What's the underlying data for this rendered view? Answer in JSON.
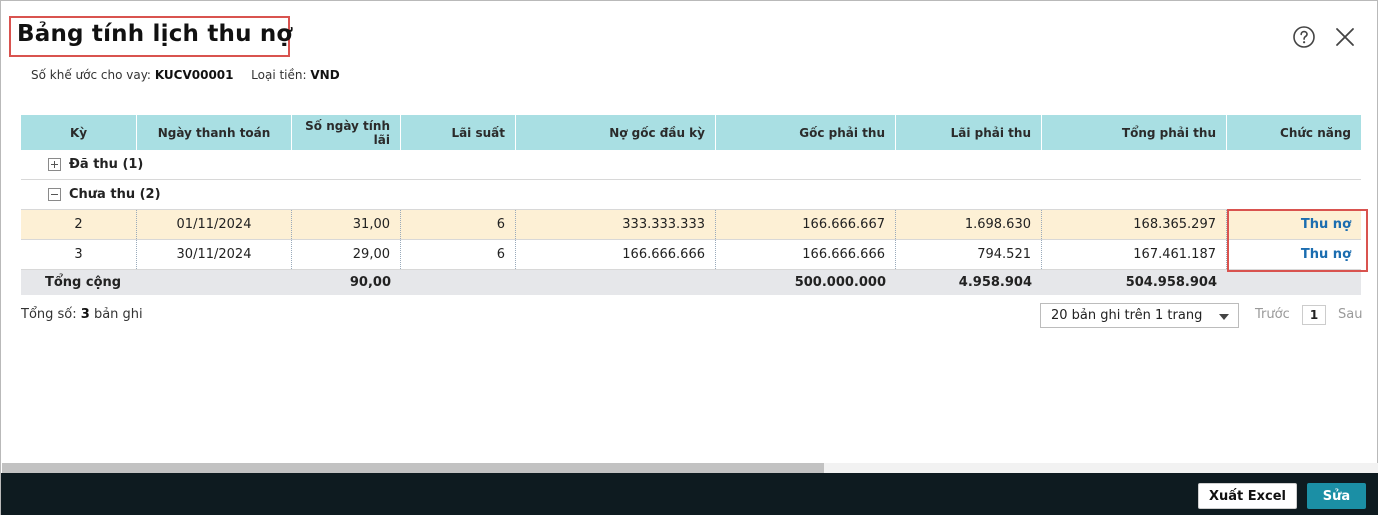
{
  "dialog": {
    "title": "Bảng tính lịch thu nợ",
    "contract_label": "Số khế ước cho vay:",
    "contract_value": "KUCV00001",
    "currency_label": "Loại tiền:",
    "currency_value": "VND"
  },
  "icons": {
    "help": "question-circle-icon",
    "close": "close-x-icon"
  },
  "table": {
    "headers": [
      "Kỳ",
      "Ngày thanh toán",
      "Số ngày tính lãi",
      "Lãi suất",
      "Nợ gốc đầu kỳ",
      "Gốc phải thu",
      "Lãi phải thu",
      "Tổng phải thu",
      "Chức năng"
    ],
    "groups": [
      {
        "label": "Đã thu (1)",
        "expanded": false
      },
      {
        "label": "Chưa thu (2)",
        "expanded": true
      }
    ],
    "rows": [
      {
        "ky": "2",
        "ngay": "01/11/2024",
        "so_ngay": "31,00",
        "lai_suat": "6",
        "no_goc": "333.333.333",
        "goc_phai_thu": "166.666.667",
        "lai_phai_thu": "1.698.630",
        "tong_phai_thu": "168.365.297",
        "action": "Thu nợ"
      },
      {
        "ky": "3",
        "ngay": "30/11/2024",
        "so_ngay": "29,00",
        "lai_suat": "6",
        "no_goc": "166.666.666",
        "goc_phai_thu": "166.666.666",
        "lai_phai_thu": "794.521",
        "tong_phai_thu": "167.461.187",
        "action": "Thu nợ"
      }
    ],
    "total": {
      "label": "Tổng cộng",
      "so_ngay": "90,00",
      "goc_phai_thu": "500.000.000",
      "lai_phai_thu": "4.958.904",
      "tong_phai_thu": "504.958.904"
    }
  },
  "pagination": {
    "count_label": "Tổng số:",
    "count_value": "3",
    "count_suffix": "bản ghi",
    "page_size": "20 bản ghi trên 1 trang",
    "prev": "Trước",
    "page": "1",
    "next": "Sau"
  },
  "footer": {
    "export_label": "Xuất Excel",
    "edit_label": "Sửa",
    "edit_color": "#1b8fa5"
  }
}
